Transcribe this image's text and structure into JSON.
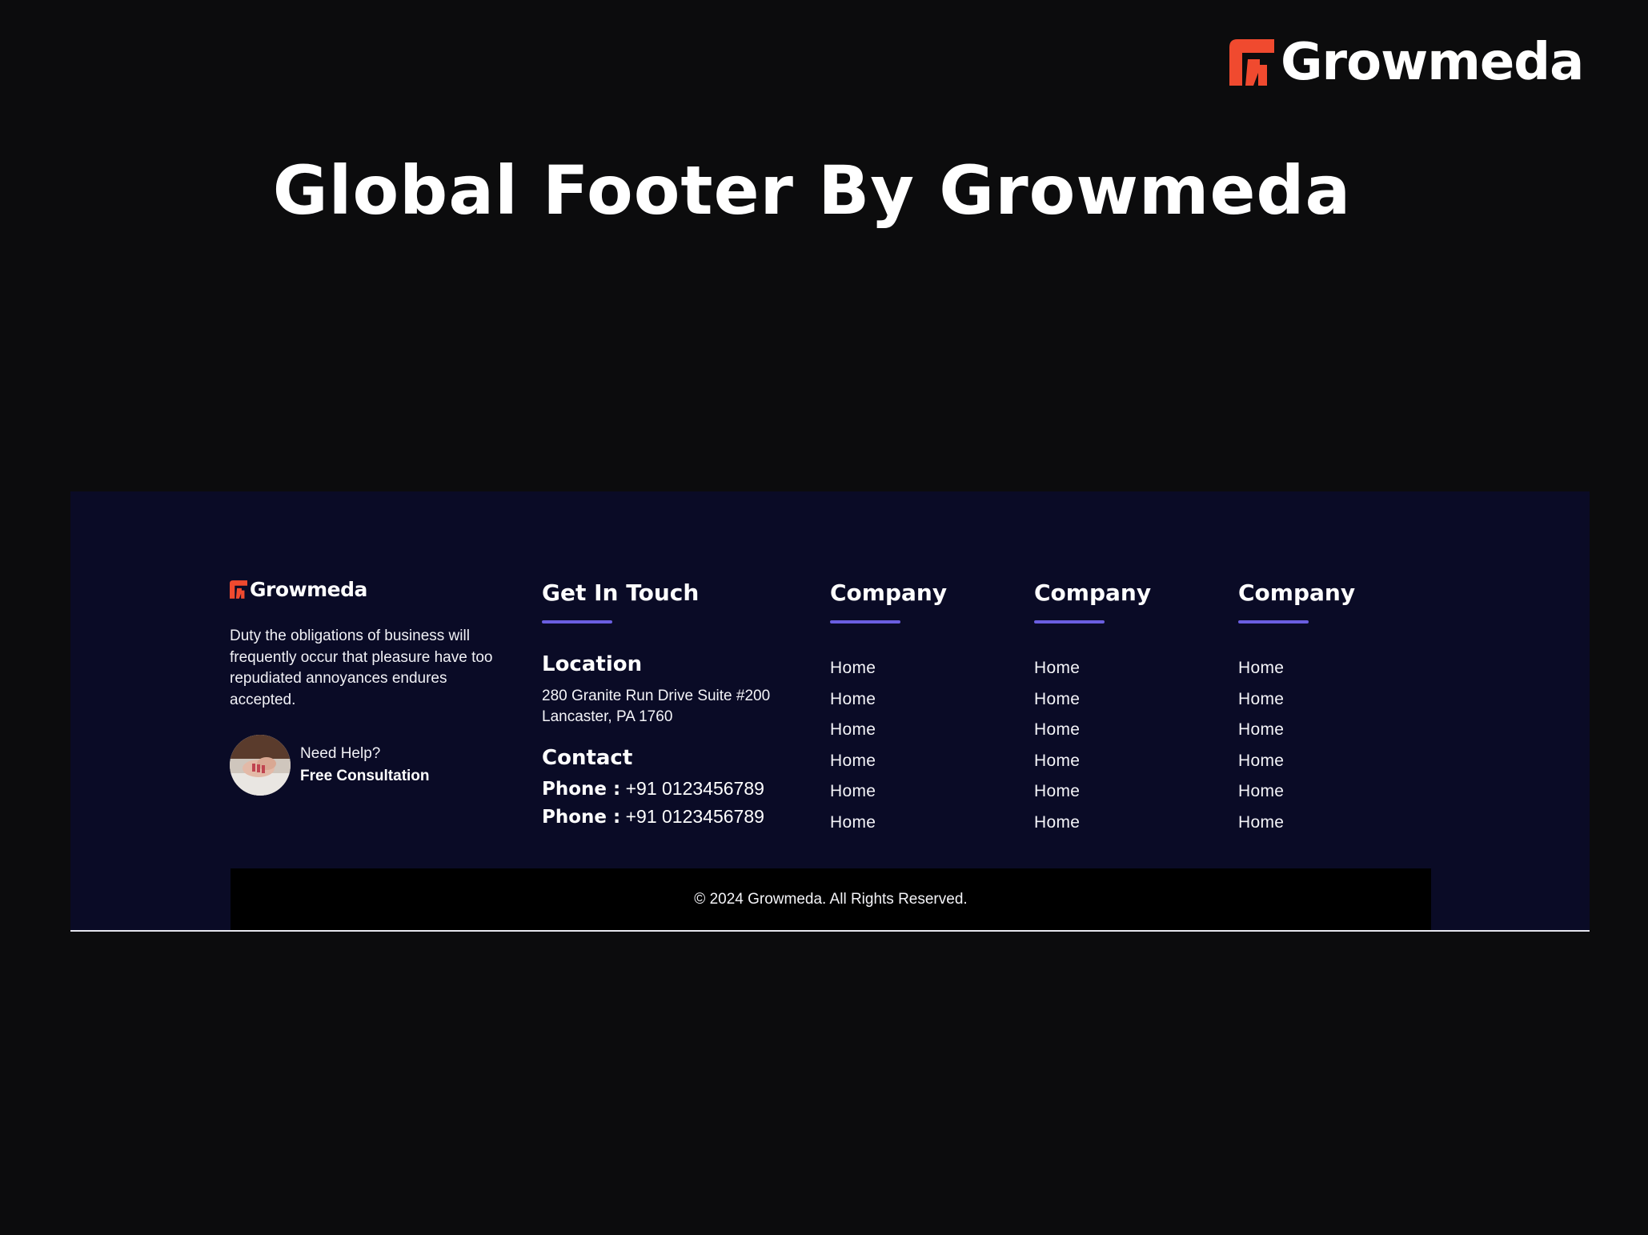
{
  "brand": {
    "name": "Growmeda",
    "accent_color": "#f04a2f",
    "logo_icon": "growmeda-logo-icon"
  },
  "hero": {
    "title": "Global Footer By Growmeda"
  },
  "footer": {
    "background": "#0a0b26",
    "underline_color": "#6a5ee0",
    "brand_column": {
      "logo_text": "Growmeda",
      "description": "Duty the obligations of business will frequently occur that pleasure have too repudiated annoyances endures accepted.",
      "help_question": "Need Help?",
      "help_cta": "Free Consultation",
      "avatar_icon": "avatar-hands-image"
    },
    "get_in_touch": {
      "heading": "Get In Touch",
      "location_heading": "Location",
      "address_line1": "280 Granite Run Drive Suite #200",
      "address_line2": "Lancaster, PA 1760",
      "contact_heading": "Contact",
      "phones": [
        {
          "label": "Phone :",
          "value": "+91 0123456789"
        },
        {
          "label": "Phone :",
          "value": "+91 0123456789"
        }
      ]
    },
    "link_columns": [
      {
        "heading": "Company",
        "links": [
          "Home",
          "Home",
          "Home",
          "Home",
          "Home",
          "Home"
        ]
      },
      {
        "heading": "Company",
        "links": [
          "Home",
          "Home",
          "Home",
          "Home",
          "Home",
          "Home"
        ]
      },
      {
        "heading": "Company",
        "links": [
          "Home",
          "Home",
          "Home",
          "Home",
          "Home",
          "Home"
        ]
      }
    ],
    "copyright": "© 2024 Growmeda. All Rights Reserved."
  }
}
